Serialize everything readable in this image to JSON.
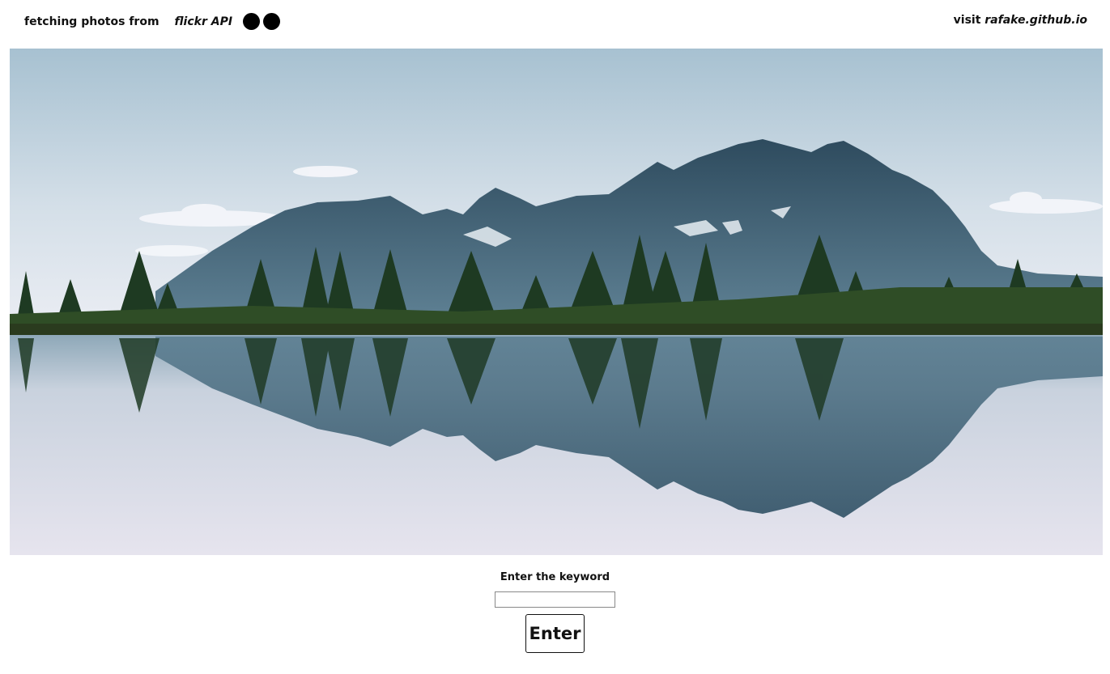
{
  "header": {
    "lead_text": "fetching photos from",
    "api_name": "flickr API",
    "visit_prefix": "visit",
    "visit_link": "rafake.github.io"
  },
  "hero": {
    "alt": "Mountain range reflected in a calm lake",
    "colors": {
      "sky_top": "#a9c3d2",
      "sky_bottom": "#eef0f5",
      "mountain": "#3f6174",
      "mountain_dark": "#2d4a5c",
      "shore": "#2f4d26",
      "trees": "#1e3a22",
      "water": "#d8dbe6"
    }
  },
  "form": {
    "label": "Enter the keyword",
    "input_value": "",
    "input_placeholder": "",
    "button_label": "Enter"
  }
}
